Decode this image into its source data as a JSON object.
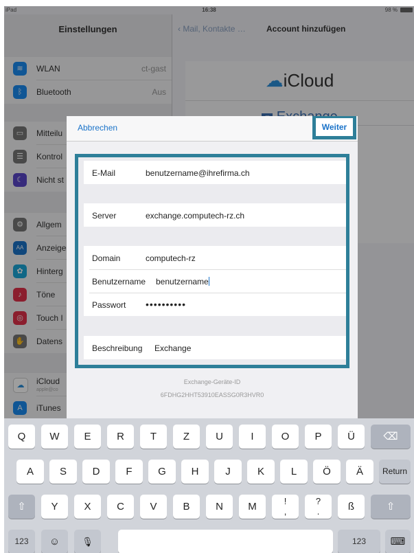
{
  "status": {
    "carrier": "iPad",
    "time": "16:38",
    "battery": "98 %"
  },
  "sidebar": {
    "title": "Einstellungen",
    "items": [
      {
        "label": "WLAN",
        "value": "ct-gast",
        "icon": "wifi-icon",
        "color": "#1a8bf0"
      },
      {
        "label": "Bluetooth",
        "value": "Aus",
        "icon": "bluetooth-icon",
        "color": "#1a8bf0"
      },
      {
        "label": "Mitteilu",
        "icon": "notifications-icon",
        "color": "#777"
      },
      {
        "label": "Kontrol",
        "icon": "control-center-icon",
        "color": "#777"
      },
      {
        "label": "Nicht st",
        "icon": "moon-icon",
        "color": "#5a46c8"
      },
      {
        "label": "Allgem",
        "icon": "gear-icon",
        "color": "#777"
      },
      {
        "label": "Anzeige",
        "icon": "display-icon",
        "color": "#1a73c9"
      },
      {
        "label": "Hinterg",
        "icon": "wallpaper-icon",
        "color": "#1aa6d8"
      },
      {
        "label": "Töne",
        "icon": "sounds-icon",
        "color": "#e0314b"
      },
      {
        "label": "Touch I",
        "icon": "fingerprint-icon",
        "color": "#e0314b"
      },
      {
        "label": "Datens",
        "icon": "hand-icon",
        "color": "#777"
      },
      {
        "label": "iCloud",
        "sub": "apple@co",
        "icon": "icloud-icon",
        "color": "#fff"
      },
      {
        "label": "iTunes",
        "icon": "app-store-icon",
        "color": "#1a8bf0"
      }
    ]
  },
  "nav": {
    "back": "Mail, Kontakte …",
    "title": "Account hinzufügen"
  },
  "accounts": {
    "icloud": "iCloud",
    "exchange": "Exchange"
  },
  "modal": {
    "cancel": "Abbrechen",
    "next": "Weiter",
    "fields": {
      "email": {
        "label": "E-Mail",
        "value": "benutzername@ihrefirma.ch"
      },
      "server": {
        "label": "Server",
        "value": "exchange.computech-rz.ch"
      },
      "domain": {
        "label": "Domain",
        "value": "computech-rz"
      },
      "username": {
        "label": "Benutzername",
        "value": "benutzername"
      },
      "password": {
        "label": "Passwort",
        "value": "••••••••••"
      },
      "description": {
        "label": "Beschreibung",
        "value": "Exchange"
      }
    },
    "device_id_label": "Exchange-Geräte-ID",
    "device_id": "6FDHG2HHT53910EASSG0R3HVR0"
  },
  "keyboard": {
    "row1": [
      "Q",
      "W",
      "E",
      "R",
      "T",
      "Z",
      "U",
      "I",
      "O",
      "P",
      "Ü"
    ],
    "row2": [
      "A",
      "S",
      "D",
      "F",
      "G",
      "H",
      "J",
      "K",
      "L",
      "Ö",
      "Ä"
    ],
    "row3": [
      "Y",
      "X",
      "C",
      "V",
      "B",
      "N",
      "M",
      "!\n,",
      "?\n.",
      "ß"
    ],
    "backspace": "⌫",
    "return": "Return",
    "shift": "⇧",
    "numbers": "123",
    "emoji": "☺",
    "mic": "🎙",
    "hide": "⌨"
  }
}
